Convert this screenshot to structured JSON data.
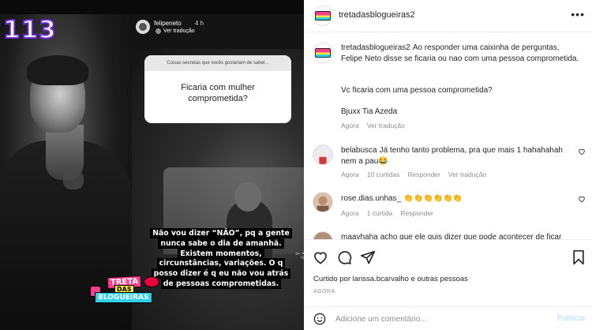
{
  "media": {
    "episode_number": "113",
    "story": {
      "username": "felipeneto",
      "time": "4 h",
      "translate_label": "Ver tradução",
      "question_prompt": "Coisas secretas que vocês gostariam de saber...",
      "question_answer": "Ficaria com mulher comprometida?",
      "caption": "Não vou dizer “NÃO”, pq a gente nunca sabe o dia de amanhã. Existem momentos, circunstâncias, variações. O q posso dizer é q eu não vou atrás de pessoas comprometidas."
    },
    "logo": {
      "line1": "TRETA",
      "line2": "DAS",
      "line3": "BLOGUEIRAS"
    }
  },
  "header": {
    "username": "tretadasblogueiras2",
    "more_icon": "more-icon"
  },
  "caption": {
    "username": "tretadasblogueiras2",
    "text": "Ao responder uma caixinha de perguntas, Felipe Neto disse se ficaria ou nao com uma pessoa comprometida.",
    "question": "Vc ficaria com uma pessoa comprometida?",
    "signature": "Bjuxx Tia Azeda",
    "time": "Agora",
    "translate": "Ver tradução"
  },
  "comments": [
    {
      "username": "belabusca",
      "text": "Já tenho tanto problema, pra que mais 1 hahahahah nem a pau😂",
      "time": "Agora",
      "likes": "10 curtidas",
      "reply": "Responder",
      "translate": "Ver tradução"
    },
    {
      "username": "rose.dias.unhas_",
      "text": "👏👏👏👏👏👏",
      "time": "Agora",
      "likes": "1 curtida",
      "reply": "Responder"
    },
    {
      "username": "maavhaha",
      "text": "acho que ele quis dizer que pode acontecer de ficar"
    }
  ],
  "actions": {
    "liked_prefix": "Curtido por",
    "liked_user": "larissa.bcarvalho",
    "liked_suffix": "e outras pessoas",
    "post_time": "AGORA"
  },
  "composer": {
    "placeholder": "Adicione um comentário...",
    "publish": "Publicar"
  }
}
